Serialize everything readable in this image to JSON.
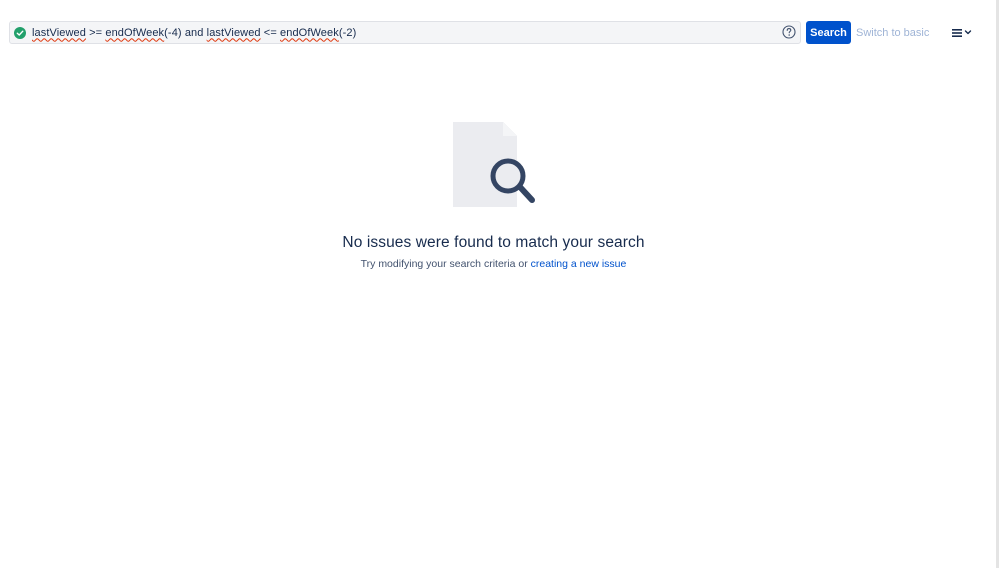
{
  "search": {
    "query_parts": {
      "field1": "lastViewed",
      "op1": " >= ",
      "func1": "endOfWeek",
      "arg1": "(-4) and ",
      "field2": "lastViewed",
      "op2": " <= ",
      "func2": "endOfWeek",
      "arg2": "(-2)"
    },
    "button_label": "Search",
    "switch_label": "Switch to basic",
    "help_icon": "question-circle-icon",
    "valid_icon": "check-circle-icon",
    "menu_icon": "hamburger-menu-icon"
  },
  "empty_state": {
    "title": "No issues were found to match your search",
    "subtitle_prefix": "Try modifying your search criteria or ",
    "link_label": "creating a new issue",
    "illustration": "document-search-icon"
  },
  "colors": {
    "primary": "#0052cc",
    "valid": "#22a06b",
    "error_underline": "#de350b",
    "text": "#172b4d",
    "subtle_link": "#9fb4d6"
  }
}
